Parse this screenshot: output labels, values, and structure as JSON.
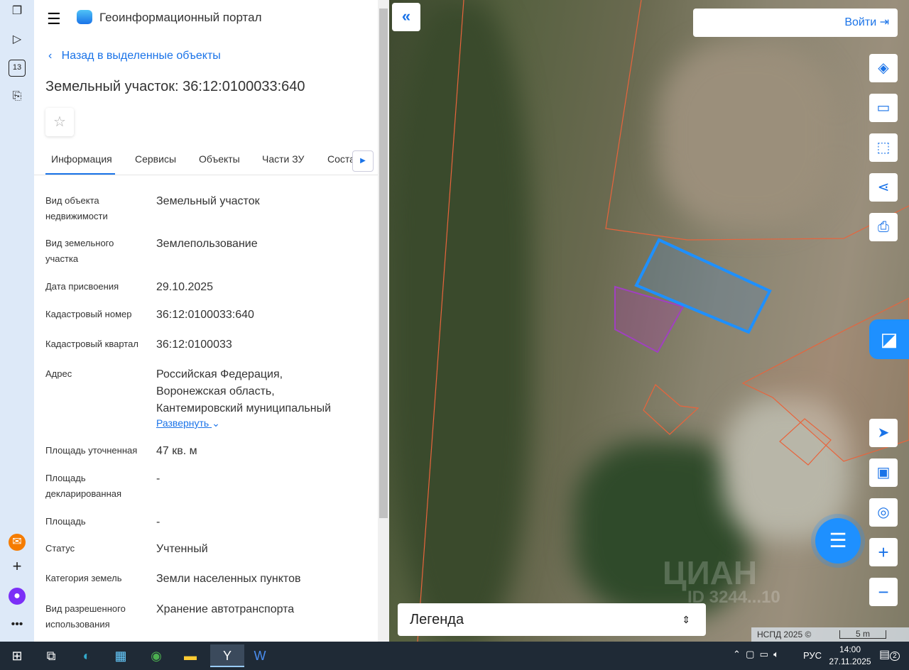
{
  "app": {
    "title": "Геоинформационный портал"
  },
  "back_link": "Назад в выделенные объекты",
  "page_title": "Земельный участок: 36:12:0100033:640",
  "tabs": [
    "Информация",
    "Сервисы",
    "Объекты",
    "Части ЗУ",
    "Состав"
  ],
  "fields": [
    {
      "label": "Вид объекта недвижимости",
      "value": "Земельный участок"
    },
    {
      "label": "Вид земельного участка",
      "value": "Землепользование"
    },
    {
      "label": "Дата присвоения",
      "value": "29.10.2025"
    },
    {
      "label": "Кадастровый номер",
      "value": "36:12:0100033:640"
    },
    {
      "label": "Кадастровый квартал",
      "value": "36:12:0100033"
    },
    {
      "label": "Адрес",
      "value": "Российская Федерация, Воронежская область, Кантемировский муниципальный"
    },
    {
      "label": "Площадь уточненная",
      "value": "47 кв. м"
    },
    {
      "label": "Площадь декларированная",
      "value": "-"
    },
    {
      "label": "Площадь",
      "value": "-"
    },
    {
      "label": "Статус",
      "value": "Учтенный"
    },
    {
      "label": "Категория земель",
      "value": "Земли населенных пунктов"
    },
    {
      "label": "Вид разрешенного использования",
      "value": "Хранение автотранспорта"
    }
  ],
  "expand_label": "Развернуть",
  "map": {
    "login": "Войти",
    "legend": "Легенда",
    "attribution": "НСПД 2025 ©",
    "scale": "5 m",
    "watermark": "ЦИАН",
    "watermark_id": "ID 3244...10"
  },
  "taskbar": {
    "lang": "РУС",
    "time": "14:00",
    "date": "27.11.2025",
    "notifications": "2"
  },
  "side_badge": "13",
  "colors": {
    "accent": "#1a73e8",
    "parcel": "#1e90ff"
  }
}
